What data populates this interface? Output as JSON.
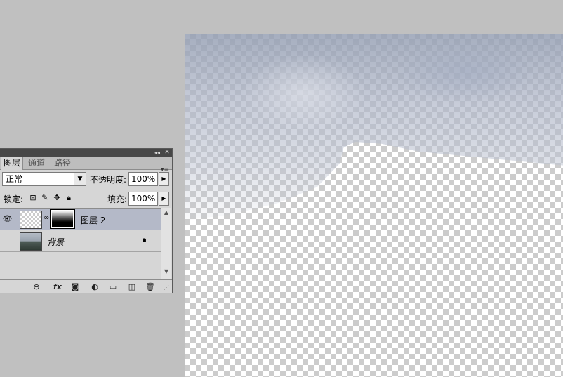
{
  "panel": {
    "tabs": [
      {
        "label": "图层",
        "active": true
      },
      {
        "label": "通道",
        "active": false
      },
      {
        "label": "路径",
        "active": false
      }
    ],
    "blend_mode": "正常",
    "opacity_label": "不透明度:",
    "opacity_value": "100%",
    "lock_label": "锁定:",
    "fill_label": "填充:",
    "fill_value": "100%",
    "layers": [
      {
        "name": "图层 2",
        "visible": true,
        "selected": true,
        "has_mask": true
      },
      {
        "name": "背景",
        "visible": false,
        "selected": false,
        "locked": true
      }
    ],
    "bottom_icons": [
      "link-icon",
      "fx-icon",
      "mask-icon",
      "adjustment-icon",
      "group-icon",
      "new-layer-icon",
      "trash-icon"
    ],
    "fx_label": "fx"
  },
  "colors": {
    "workspace": "#c0c0c0",
    "panel_bg": "#d6d6d6",
    "titlebar": "#474747",
    "selected_layer": "#b4b9c8"
  }
}
